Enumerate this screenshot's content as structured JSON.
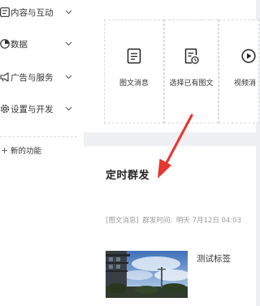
{
  "sidebar": {
    "items": [
      {
        "label": "内容与互动",
        "icon": "content-icon"
      },
      {
        "label": "数据",
        "icon": "data-icon"
      },
      {
        "label": "广告与服务",
        "icon": "ads-icon"
      },
      {
        "label": "设置与开发",
        "icon": "settings-icon"
      }
    ],
    "new_feature": {
      "symbol": "+",
      "label": "新的功能"
    }
  },
  "content_types": [
    {
      "label": "图文消息",
      "icon": "document-icon"
    },
    {
      "label": "选择已有图文",
      "icon": "document-clock-icon"
    },
    {
      "label": "视频消",
      "icon": "video-play-icon"
    }
  ],
  "scheduled": {
    "title": "定时群发",
    "type_tag": "[图文消息]",
    "time_label": "群发时间:",
    "time_value": "明天 7月12日 04:03",
    "article": {
      "title": "测试标签",
      "thumbnail": "outdoor-sky-photo"
    }
  },
  "colors": {
    "annotation_arrow": "#e8352e",
    "page_background": "#eef0f3",
    "card_background": "#ffffff"
  }
}
